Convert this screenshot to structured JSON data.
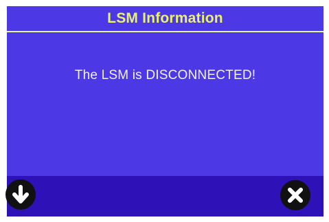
{
  "window": {
    "title": "LSM Information"
  },
  "main": {
    "message": "The LSM is DISCONNECTED!"
  },
  "toolbar": {
    "down_icon": "arrow-down-icon",
    "close_icon": "close-icon"
  },
  "colors": {
    "background": "#4d38e6",
    "title_text": "#e8f36a",
    "message_text": "#f3f1ff",
    "bottom_bar": "#2f11b8",
    "icon_circle": "#111111"
  }
}
